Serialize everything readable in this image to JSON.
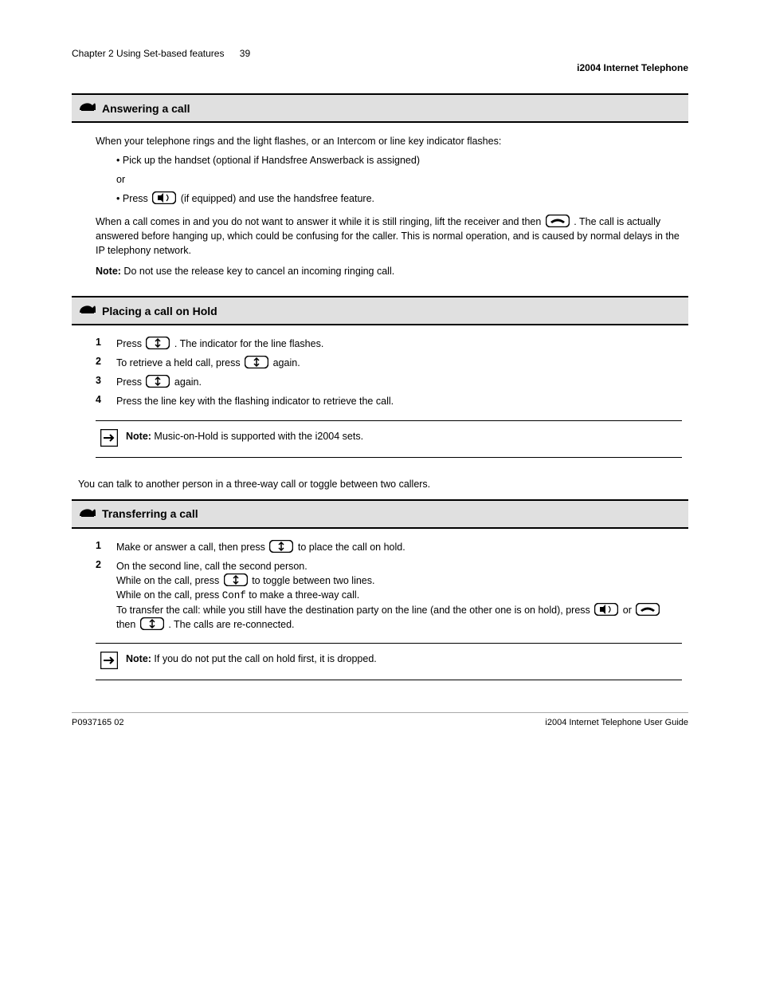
{
  "header": {
    "line": "Chapter 2 Using Set-based features",
    "page": "39",
    "title_right": "i2004 Internet Telephone"
  },
  "section1": {
    "title": "Answering a call",
    "intro": "When your telephone rings and the light flashes, or an Intercom or line key indicator flashes:",
    "bullet_a": "Pick up the handset (optional if Handsfree Answerback is assigned)",
    "or": "or",
    "bullet_b_pre": "Press ",
    "bullet_b_post": " (if equipped) and use the handsfree feature.",
    "after": "When a call comes in and you do not want to answer it while it is still ringing, lift the receiver and then ",
    "after_post": ". The call is actually answered before hanging up, which could be confusing for the caller. This is normal operation, and is caused by normal delays in the IP telephony network.",
    "note_label": "Note:",
    "note": " Do not use the release key to cancel an incoming ringing call."
  },
  "section2": {
    "title": "Placing a call on Hold",
    "step1_pre": "Press ",
    "step1_post": ". The indicator for the line flashes.",
    "step2_pre": "To retrieve a held call, press",
    "step2_post": "again.",
    "step3_pre": "Press",
    "step3_post": "again.",
    "step4": "Press the line key with the flashing indicator to retrieve the call.",
    "note_label": "Note:",
    "note": " Music-on-Hold is supported with the i2004 sets."
  },
  "pre_section3": "You can talk to another person in a three-way call or toggle between two callers.",
  "section3": {
    "title": "Transferring a call",
    "step1_pre": "Make or answer a call, then press ",
    "step1_post": " to place the call on hold.",
    "step2a": "On the second line, call the second person.",
    "step2b_pre": "While on the call, press",
    "step2b_post": "to toggle between two lines.",
    "step2c_pre": "While on the call, press",
    "step2c_mid": "Conf",
    "step2c_post": " to make a three-way call.",
    "step2d_pre": "To transfer the call: while you still have the destination party on the line (and the other one is on hold), press",
    "step2d_mid": "then",
    "step2d_post": ". The calls are re-connected.",
    "note_label": "Note:",
    "note": " If you do not put the call on hold first, it is dropped."
  },
  "footer": {
    "left": "P0937165 02",
    "right": "i2004 Internet Telephone User Guide"
  },
  "icons": {
    "phone": "phone-icon",
    "speaker": "speaker-icon",
    "release": "release-icon",
    "hold": "hold-icon",
    "arrow": "arrow-icon"
  }
}
